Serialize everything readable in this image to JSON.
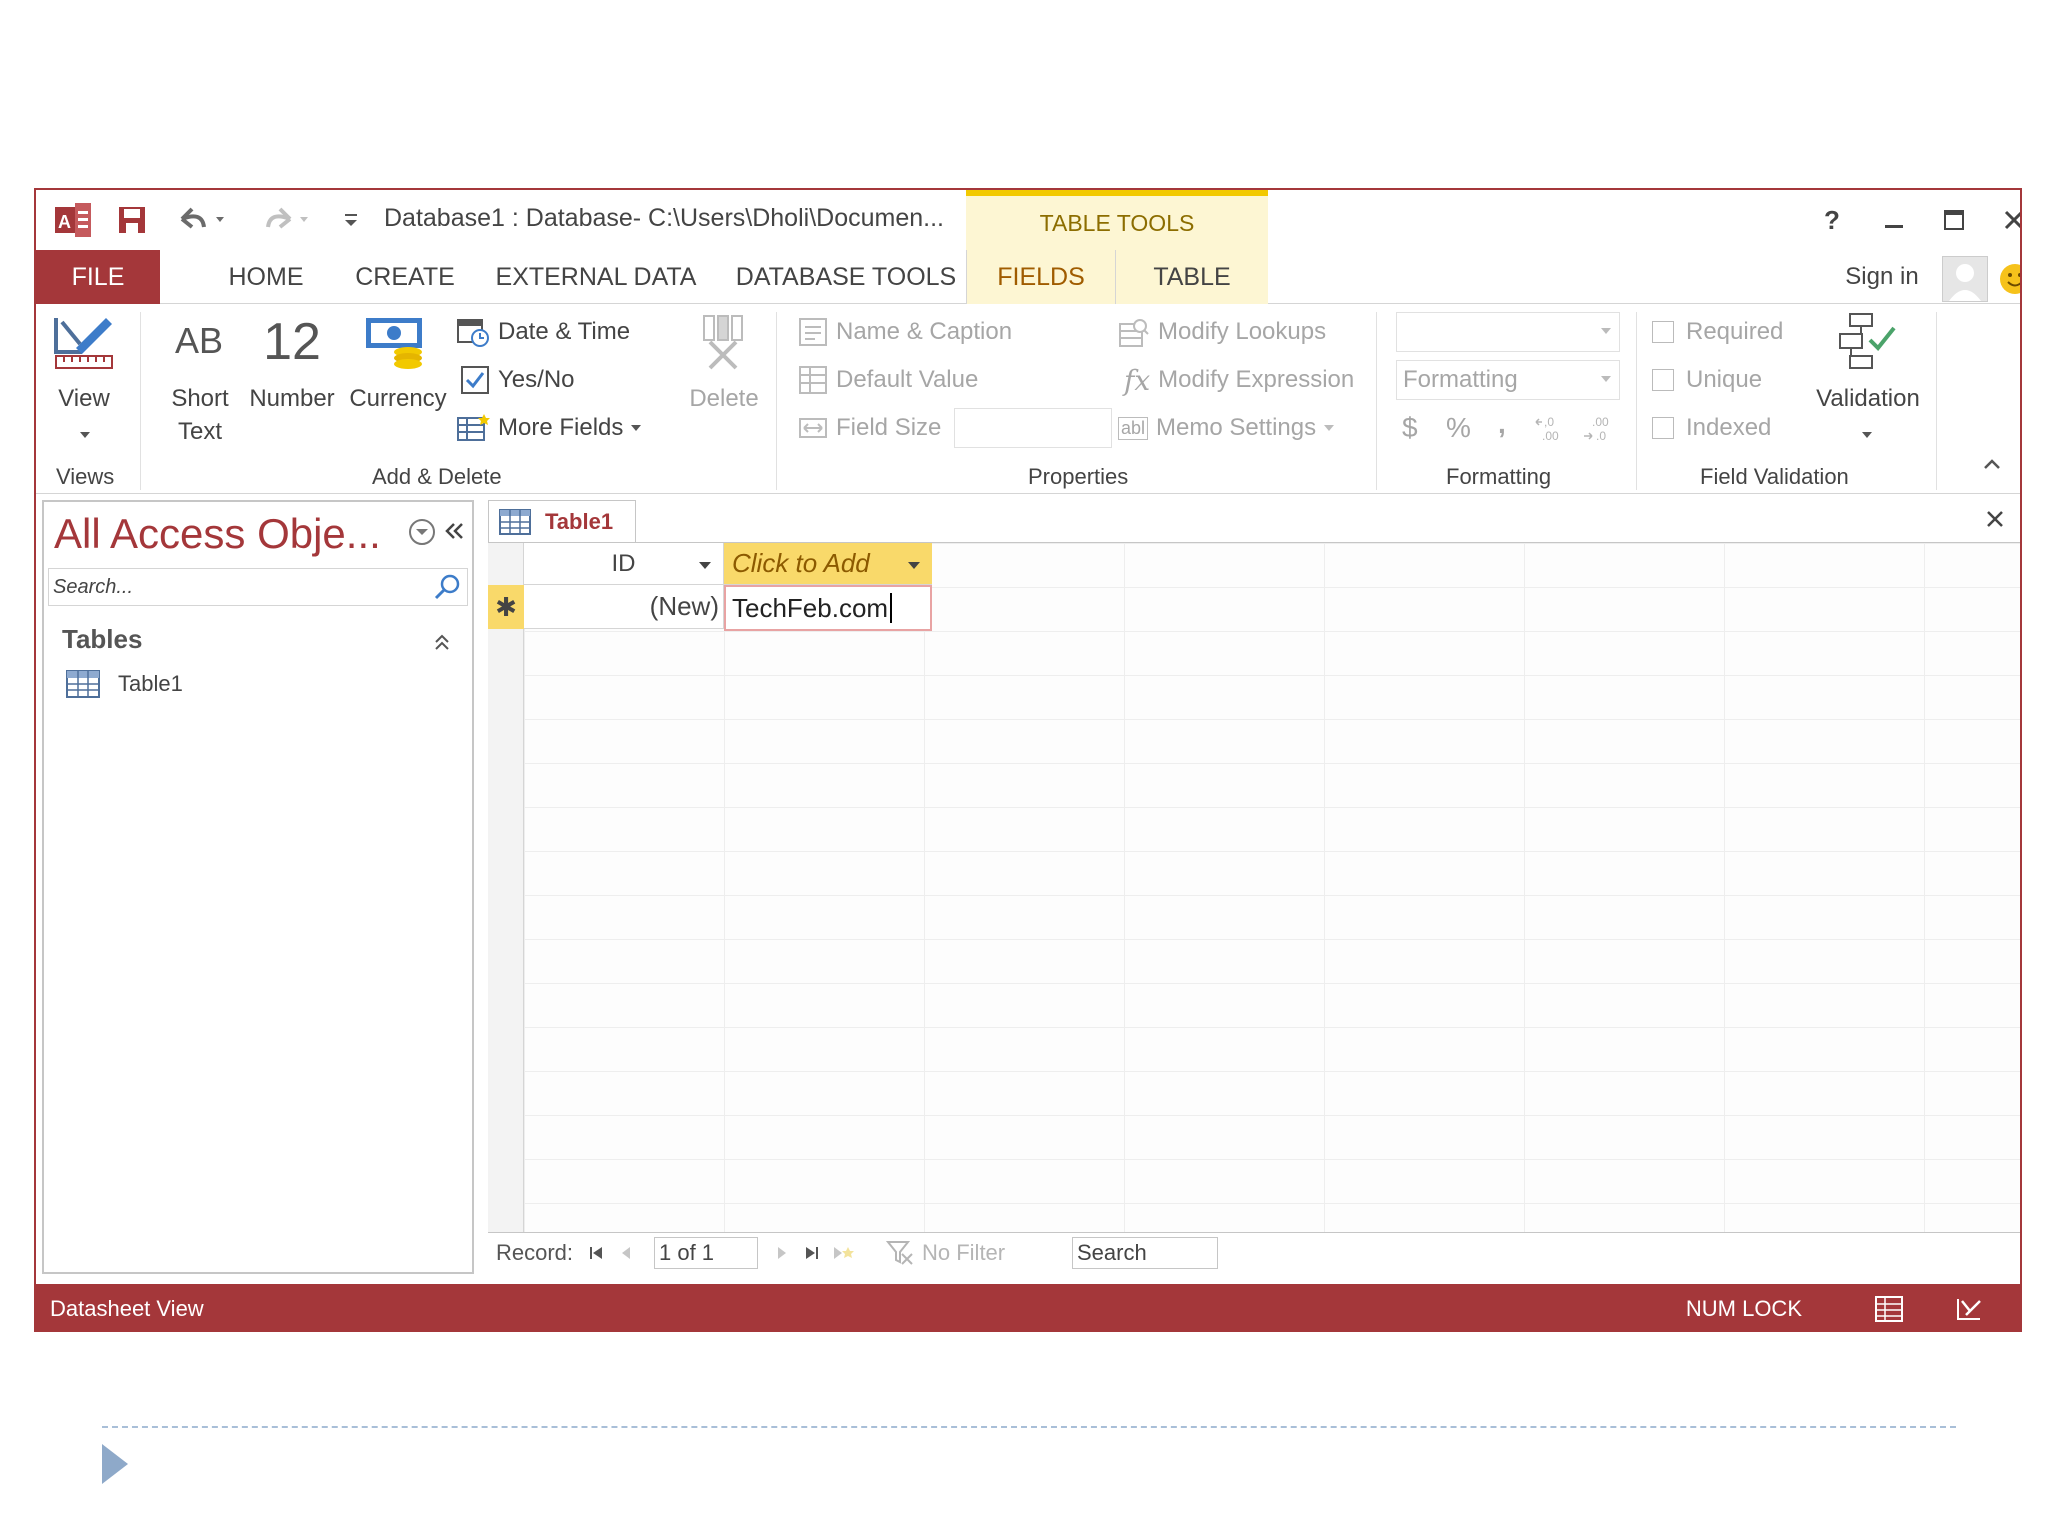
{
  "app": {
    "title": "Database1 : Database- C:\\Users\\Dholi\\Documen...",
    "table_tools_label": "TABLE TOOLS",
    "help": "?",
    "sign_in": "Sign in"
  },
  "tabs": {
    "file": "FILE",
    "home": "HOME",
    "create": "CREATE",
    "external_data": "EXTERNAL DATA",
    "database_tools": "DATABASE TOOLS",
    "fields": "FIELDS",
    "table": "TABLE"
  },
  "ribbon": {
    "views": {
      "view": "View",
      "group": "Views"
    },
    "add_delete": {
      "short_text_icon": "AB",
      "short_text": "Short Text",
      "number_icon": "12",
      "number": "Number",
      "currency": "Currency",
      "date_time": "Date & Time",
      "yes_no": "Yes/No",
      "more_fields": "More Fields",
      "delete": "Delete",
      "group": "Add & Delete"
    },
    "properties": {
      "name_caption": "Name & Caption",
      "default_value": "Default Value",
      "field_size": "Field Size",
      "modify_lookups": "Modify Lookups",
      "modify_expression": "Modify Expression",
      "memo_settings": "Memo Settings",
      "group": "Properties"
    },
    "formatting": {
      "formatting_dropdown": "Formatting",
      "currency_symbol": "$",
      "percent_symbol": "%",
      "comma_symbol": ",",
      "group": "Formatting"
    },
    "field_validation": {
      "required": "Required",
      "unique": "Unique",
      "indexed": "Indexed",
      "validation": "Validation",
      "group": "Field Validation"
    }
  },
  "nav_pane": {
    "title": "All Access Obje...",
    "search_placeholder": "Search...",
    "section": "Tables",
    "items": [
      {
        "label": "Table1"
      }
    ]
  },
  "document": {
    "tab_label": "Table1",
    "columns": {
      "id": "ID",
      "click_to_add": "Click to Add"
    },
    "new_row": {
      "selector": "✱",
      "id": "(New)",
      "edit_value": "TechFeb.com"
    }
  },
  "record_nav": {
    "record_label": "Record:",
    "position": "1 of 1",
    "filter": "No Filter",
    "search": "Search"
  },
  "status_bar": {
    "view": "Datasheet View",
    "num_lock": "NUM LOCK"
  },
  "colors": {
    "access_red": "#a4373a",
    "table_tools_yellow": "#fdf6d3",
    "header_highlight": "#f9d96a"
  }
}
